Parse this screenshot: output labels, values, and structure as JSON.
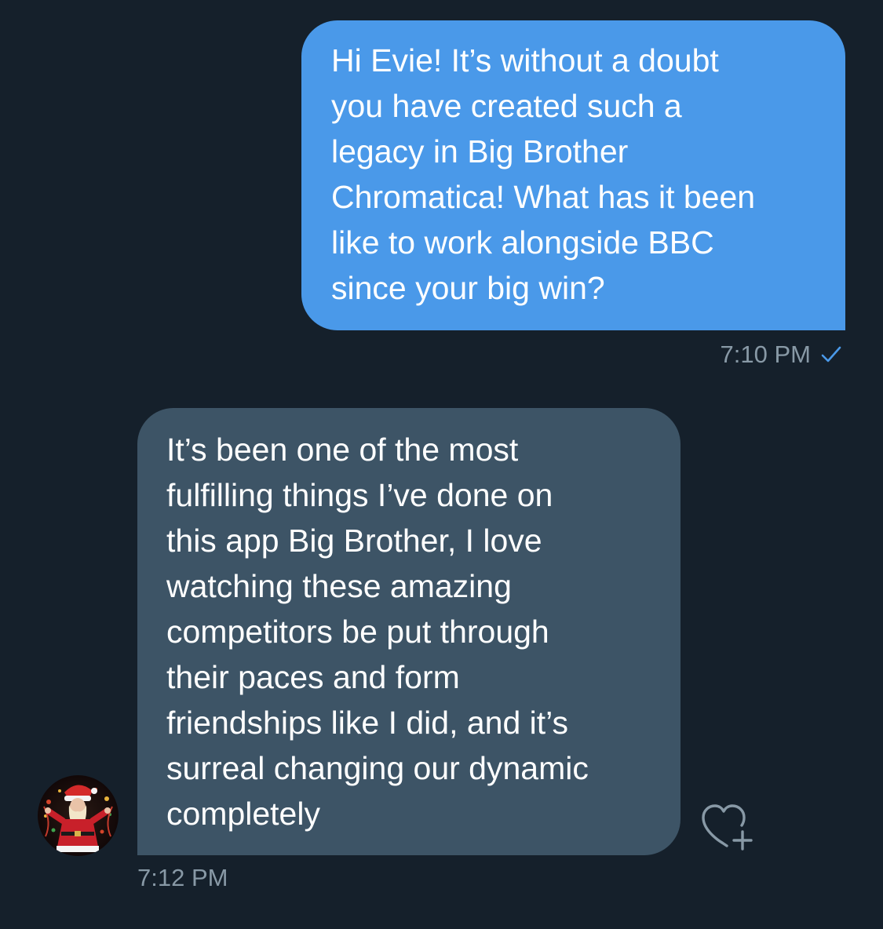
{
  "conversation": {
    "sent_message": {
      "text": "Hi Evie! It’s without a doubt\nyou have created such a\nlegacy in Big Brother\nChromatica! What has it been\nlike to work alongside BBC\nsince your big win?",
      "time": "7:10 PM",
      "status_icon": "check-icon"
    },
    "received_message": {
      "text": "It’s been one of the most\nfulfilling things I’ve done on\nthis app Big Brother, I love\nwatching these amazing\ncompetitors be put through\ntheir paces and form\nfriendships like I did, and it’s\nsurreal changing our dynamic\ncompletely",
      "time": "7:12 PM",
      "avatar_icon": "avatar",
      "reaction_icon": "heart-plus-icon"
    }
  },
  "colors": {
    "background": "#15202b",
    "sent_bubble": "#4a99e9",
    "received_bubble": "#3d5466",
    "timestamp": "#8899a6",
    "check": "#4a99e9"
  }
}
